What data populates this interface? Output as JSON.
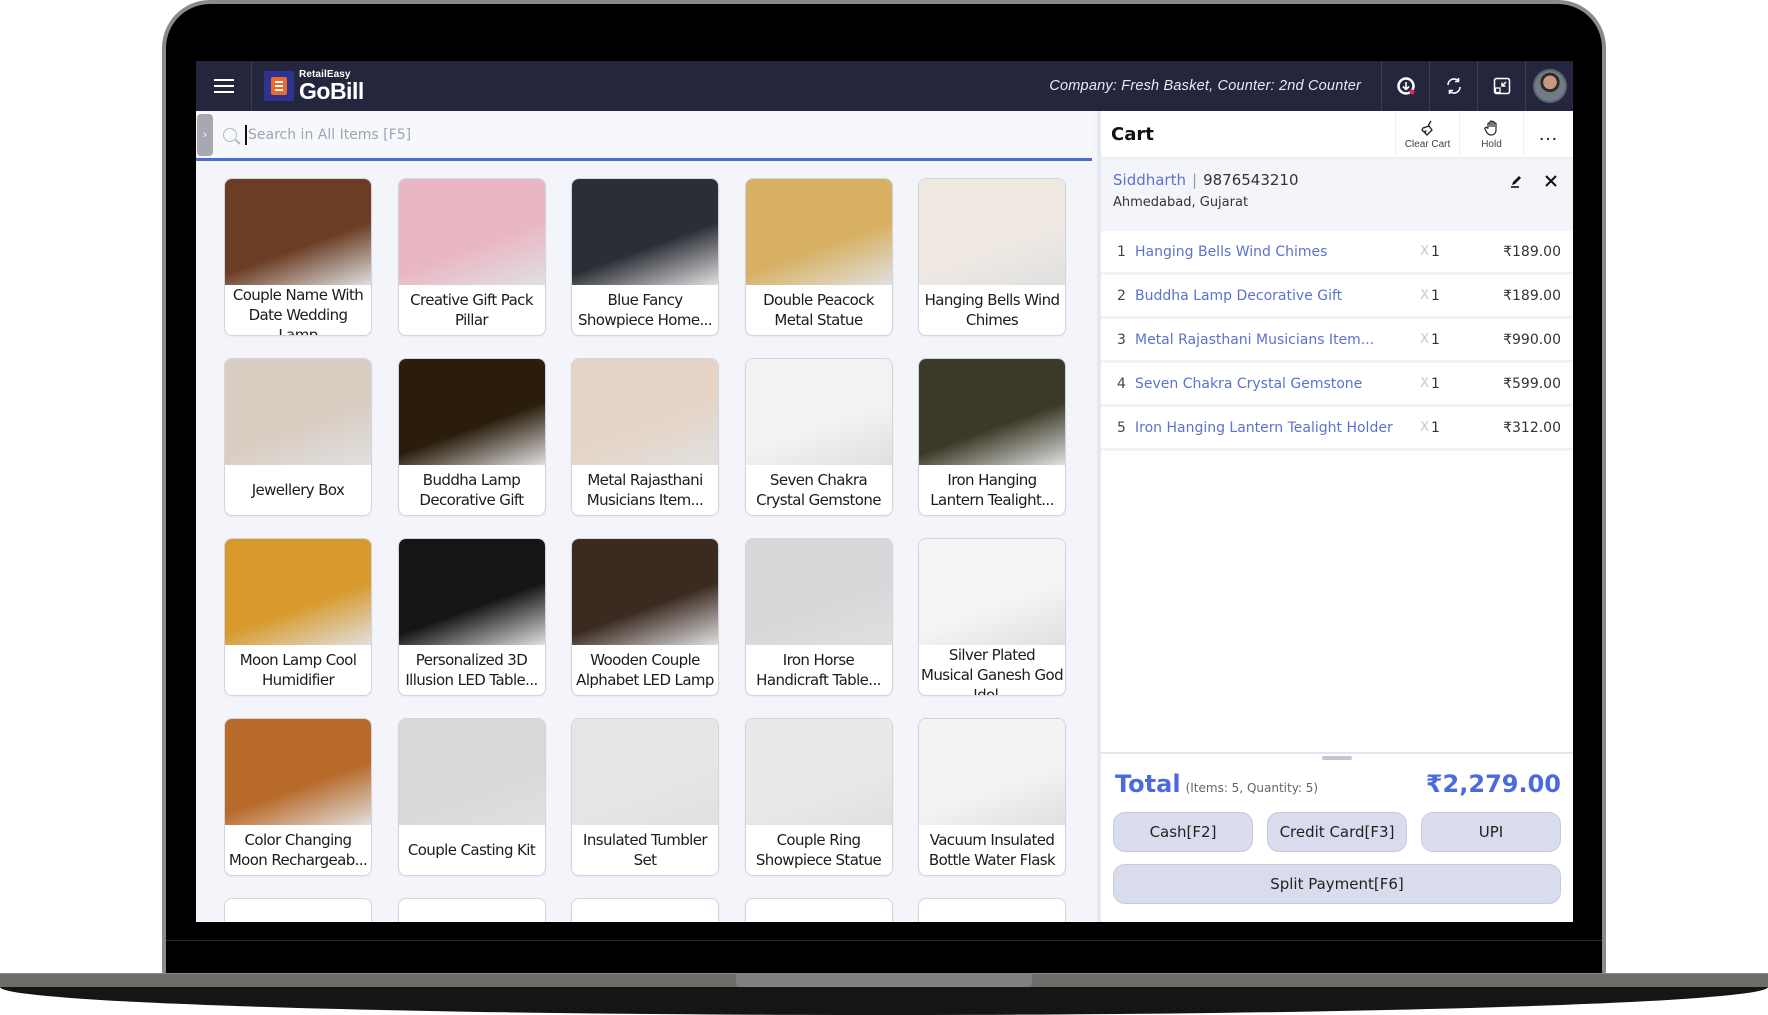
{
  "app": {
    "brand_small": "RetailEasy",
    "brand_big": "GoBill",
    "company_info": "Company: Fresh Basket,  Counter: 2nd Counter",
    "header_icons": [
      "sync-download-icon",
      "refresh-icon",
      "exit-fullscreen-icon",
      "user-avatar"
    ]
  },
  "search": {
    "placeholder": "Search in All Items [F5]",
    "value": ""
  },
  "products": [
    {
      "name": "Couple Name With Date Wedding Lamp",
      "color": "#6b3d24"
    },
    {
      "name": "Creative Gift Pack Pillar",
      "color": "#e9b7c4"
    },
    {
      "name": "Blue Fancy Showpiece Home...",
      "color": "#2b2e36"
    },
    {
      "name": "Double Peacock Metal Statue",
      "color": "#d8b063"
    },
    {
      "name": "Hanging Bells Wind Chimes",
      "color": "#efe9e2"
    },
    {
      "name": "Jewellery Box",
      "color": "#d9cdc2"
    },
    {
      "name": "Buddha Lamp Decorative Gift",
      "color": "#2a1d0c"
    },
    {
      "name": "Metal Rajasthani Musicians Item...",
      "color": "#e6d5c7"
    },
    {
      "name": "Seven Chakra Crystal Gemstone",
      "color": "#f2f2f2"
    },
    {
      "name": "Iron Hanging Lantern Tealight...",
      "color": "#3b3a27"
    },
    {
      "name": "Moon Lamp Cool Humidifier",
      "color": "#d89a2c"
    },
    {
      "name": "Personalized 3D Illusion LED Table...",
      "color": "#151515"
    },
    {
      "name": "Wooden Couple Alphabet LED Lamp",
      "color": "#3a2a20"
    },
    {
      "name": "Iron Horse Handicraft Table...",
      "color": "#d8d8da"
    },
    {
      "name": "Silver Plated Musical Ganesh God Idol...",
      "color": "#f4f4f4"
    },
    {
      "name": "Color Changing Moon Rechargeab...",
      "color": "#b86a2a"
    },
    {
      "name": "Couple Casting Kit",
      "color": "#d9d9d9"
    },
    {
      "name": "Insulated Tumbler Set",
      "color": "#e6e6e6"
    },
    {
      "name": "Couple Ring Showpiece Statue",
      "color": "#e9e9e9"
    },
    {
      "name": "Vacuum Insulated Bottle Water Flask",
      "color": "#f3f3f3"
    }
  ],
  "cart": {
    "title": "Cart",
    "clear_label": "Clear Cart",
    "hold_label": "Hold",
    "more_label": "…",
    "customer": {
      "name": "Siddharth",
      "separator": "|",
      "phone": "9876543210",
      "address": "Ahmedabad, Gujarat"
    },
    "items": [
      {
        "num": "1",
        "name": "Hanging Bells Wind Chimes",
        "x": "X",
        "qty": "1",
        "price": "₹189.00"
      },
      {
        "num": "2",
        "name": "Buddha Lamp Decorative Gift",
        "x": "X",
        "qty": "1",
        "price": "₹189.00"
      },
      {
        "num": "3",
        "name": "Metal Rajasthani Musicians Item...",
        "x": "X",
        "qty": "1",
        "price": "₹990.00"
      },
      {
        "num": "4",
        "name": "Seven Chakra Crystal Gemstone",
        "x": "X",
        "qty": "1",
        "price": "₹599.00"
      },
      {
        "num": "5",
        "name": "Iron Hanging Lantern Tealight Holder",
        "x": "X",
        "qty": "1",
        "price": "₹312.00"
      }
    ],
    "total_label": "Total",
    "total_meta": "(Items: 5, Quantity: 5)",
    "total_amount": "₹2,279.00",
    "payments": {
      "cash": "Cash[F2]",
      "card": "Credit Card[F3]",
      "upi": "UPI",
      "split": "Split Payment[F6]"
    }
  },
  "colors": {
    "header_bg": "#24263e",
    "accent": "#4c6adb",
    "link": "#5b72cf",
    "pay_button": "#d9dcec"
  }
}
